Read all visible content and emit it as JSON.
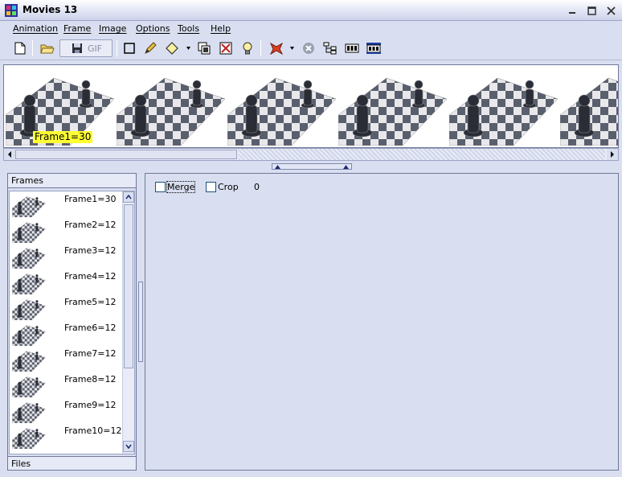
{
  "window": {
    "title": "Movies 13"
  },
  "menu": [
    "Animation",
    "Frame",
    "Image",
    "Options",
    "Tools",
    "Help"
  ],
  "toolbar": {
    "gif_label": "GIF",
    "icons": [
      "new-file-icon",
      "open-folder-icon",
      "save-gif-icon",
      "rectangle-icon",
      "pencil-icon",
      "diamond-icon",
      "layers-icon",
      "delete-frame-icon",
      "lightbulb-icon",
      "animation-effect-icon",
      "stop-icon",
      "tree-icon",
      "frame-strip-icon",
      "frame-strip-selected-icon"
    ]
  },
  "filmstrip": {
    "badge": "Frame1=30"
  },
  "frames_panel": {
    "header": "Frames",
    "footer": "Files",
    "items": [
      "Frame1=30",
      "Frame2=12",
      "Frame3=12",
      "Frame4=12",
      "Frame5=12",
      "Frame6=12",
      "Frame7=12",
      "Frame8=12",
      "Frame9=12",
      "Frame10=12"
    ]
  },
  "props": {
    "merge_label": "Merge",
    "crop_label": "Crop",
    "crop_value": "0"
  },
  "colors": {
    "accent": "#ffff33",
    "panel": "#d9dff0"
  }
}
